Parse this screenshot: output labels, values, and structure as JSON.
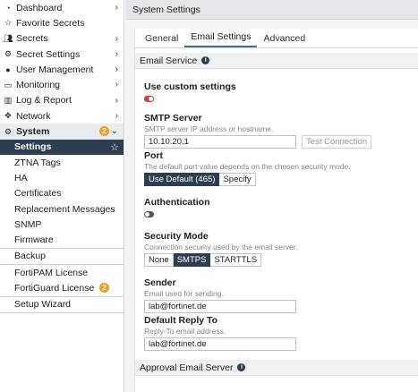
{
  "sidebar": {
    "items": [
      {
        "label": "Dashboard"
      },
      {
        "label": "Favorite Secrets"
      },
      {
        "label": "Secrets"
      },
      {
        "label": "Secret Settings"
      },
      {
        "label": "User Management"
      },
      {
        "label": "Monitoring"
      },
      {
        "label": "Log & Report"
      },
      {
        "label": "Network"
      },
      {
        "label": "System",
        "badge": "2"
      }
    ],
    "system_sub": [
      {
        "label": "Settings"
      },
      {
        "label": "ZTNA Tags"
      },
      {
        "label": "HA"
      },
      {
        "label": "Certificates"
      },
      {
        "label": "Replacement Messages"
      },
      {
        "label": "SNMP"
      },
      {
        "label": "Firmware"
      }
    ],
    "bottom": [
      {
        "label": "Backup"
      },
      {
        "label": "FortiPAM License"
      },
      {
        "label": "FortiGuard License",
        "badge": "2"
      },
      {
        "label": "Setup Wizard"
      }
    ]
  },
  "header": {
    "title": "System Settings"
  },
  "tabs": [
    {
      "label": "General"
    },
    {
      "label": "Email Settings"
    },
    {
      "label": "Advanced"
    }
  ],
  "email_service": {
    "section_title": "Email Service",
    "custom_label": "Use custom settings",
    "smtp_label": "SMTP Server",
    "smtp_hint": "SMTP server IP address or hostname.",
    "smtp_value": "10.10.20.1",
    "test_button": "Test Connection",
    "port_label": "Port",
    "port_hint": "The default port value depends on the chosen security mode.",
    "port_default": "Use Default (465)",
    "port_specify": "Specify",
    "auth_label": "Authentication",
    "security_label": "Security Mode",
    "security_hint": "Connection security used by the email server.",
    "security_options": [
      "None",
      "SMTPS",
      "STARTTLS"
    ],
    "sender_label": "Sender",
    "sender_hint": "Email used for sending.",
    "sender_value": "lab@fortinet.de",
    "reply_label": "Default Reply To",
    "reply_hint": "Reply-To email address.",
    "reply_value": "lab@fortinet.de"
  },
  "approval": {
    "section_title": "Approval Email Server"
  },
  "colors": {
    "accent": "#2d3e50",
    "toggle_on": "#d9353a",
    "badge": "#f0a020"
  }
}
